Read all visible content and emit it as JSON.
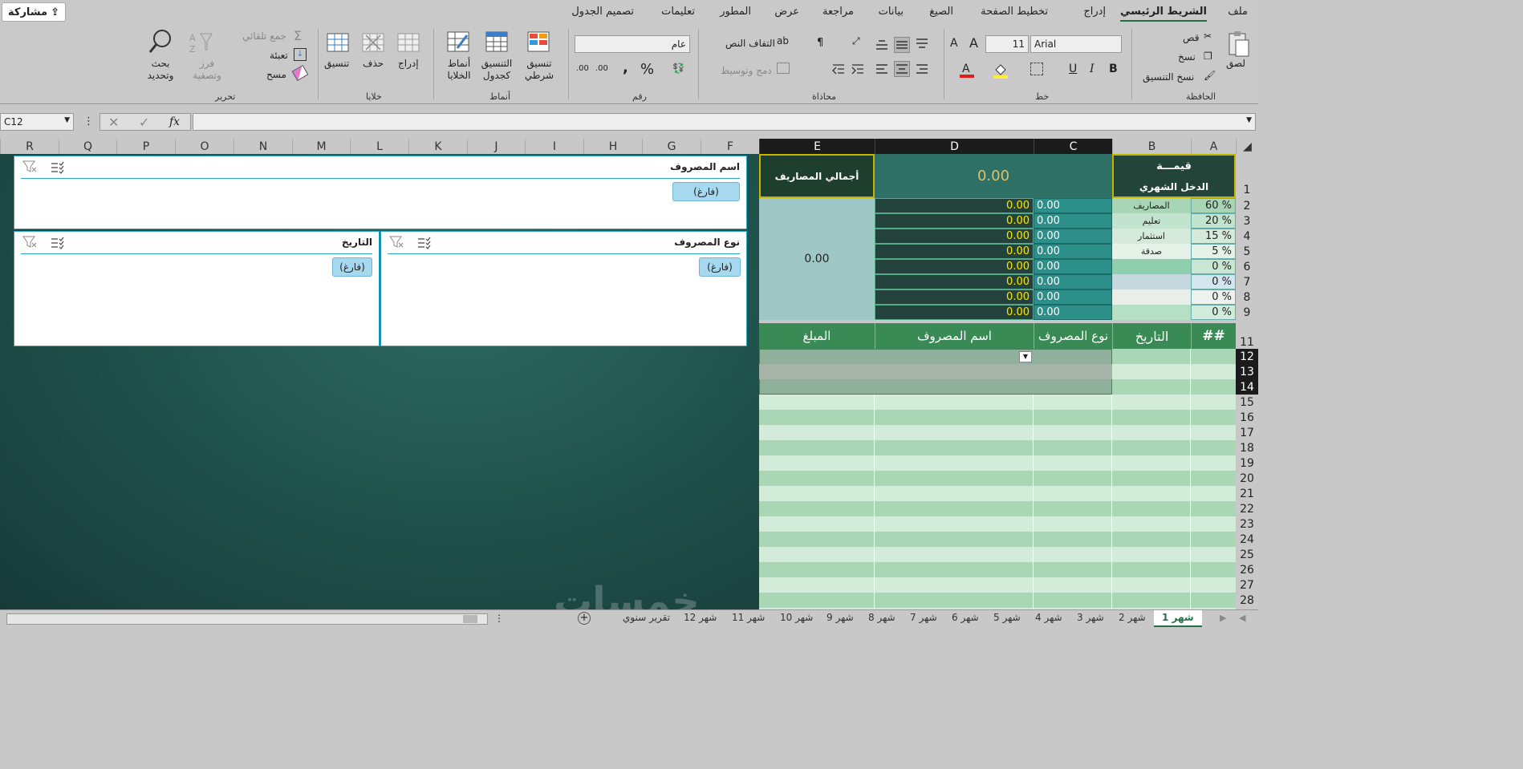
{
  "tabs": [
    "ملف",
    "الشريط الرئيسي",
    "إدراج",
    "تخطيط الصفحة",
    "الصيغ",
    "بيانات",
    "مراجعة",
    "عرض",
    "المطور",
    "تعليمات",
    "تصميم الجدول"
  ],
  "share_label": "مشاركة",
  "ribbon": {
    "clipboard": {
      "paste": "لصق",
      "cut": "قص",
      "copy": "نسخ",
      "format_painter": "نسخ التنسيق",
      "label": "الحافظة"
    },
    "font": {
      "name": "Arial",
      "size": "11",
      "bold": "B",
      "italic": "I",
      "underline": "U",
      "label": "خط"
    },
    "alignment": {
      "wrap": "التفاف النص",
      "merge": "دمج وتوسيط",
      "label": "محاذاة"
    },
    "number": {
      "format": "عام",
      "percent": "%",
      "comma": ",",
      "inc_dec": ".00",
      "label": "رقم"
    },
    "styles": {
      "conditional": "تنسيق شرطي",
      "as_table": "التنسيق كجدول",
      "cell_styles": "أنماط الخلايا",
      "label": "أنماط"
    },
    "cells": {
      "insert": "إدراج",
      "delete": "حذف",
      "format": "تنسيق",
      "label": "خلايا"
    },
    "editing": {
      "autosum": "جمع تلقائي",
      "fill": "تعبئة",
      "clear": "مسح",
      "sort": "فرز وتصفية",
      "find": "بحث وتحديد",
      "label": "تحرير"
    }
  },
  "formula_bar": {
    "name_box": "C12",
    "fx": "fx",
    "formula": ""
  },
  "columns": [
    "A",
    "B",
    "C",
    "D",
    "E",
    "F",
    "G",
    "H",
    "I",
    "J",
    "K",
    "L",
    "M",
    "N",
    "O",
    "P",
    "Q",
    "R"
  ],
  "rows": [
    "1",
    "2",
    "3",
    "4",
    "5",
    "6",
    "7",
    "8",
    "9",
    "11",
    "12",
    "13",
    "14",
    "15",
    "16",
    "17",
    "18",
    "19",
    "20",
    "21",
    "22",
    "23",
    "24",
    "25",
    "26",
    "27",
    "28"
  ],
  "summary": {
    "value_title": "قيمـــة",
    "income_title": "الدخل الشهري",
    "income_value": "0.00",
    "total_expenses_label": "أجمالي المصاريف",
    "total_expenses_value": "0.00",
    "categories": [
      {
        "pct": "60 %",
        "name": "المصاريف",
        "c": "0.00",
        "d": "0.00"
      },
      {
        "pct": "20 %",
        "name": "تعليم",
        "c": "0.00",
        "d": "0.00"
      },
      {
        "pct": "15 %",
        "name": "استثمار",
        "c": "0.00",
        "d": "0.00"
      },
      {
        "pct": "5 %",
        "name": "صدقة",
        "c": "0.00",
        "d": "0.00"
      },
      {
        "pct": "0 %",
        "name": "",
        "c": "0.00",
        "d": "0.00"
      },
      {
        "pct": "0 %",
        "name": "",
        "c": "0.00",
        "d": "0.00"
      },
      {
        "pct": "0 %",
        "name": "",
        "c": "0.00",
        "d": "0.00"
      },
      {
        "pct": "0 %",
        "name": "",
        "c": "0.00",
        "d": "0.00"
      }
    ]
  },
  "table_headers": [
    "##",
    "التاريخ",
    "نوع المصروف",
    "اسم المصروف",
    "المبلغ"
  ],
  "slicers": [
    {
      "title": "اسم المصروف",
      "item": "(فارغ)"
    },
    {
      "title": "نوع المصروف",
      "item": "(فارغ)"
    },
    {
      "title": "التاريخ",
      "item": "(فارغ)"
    }
  ],
  "sheet_tabs": [
    "شهر 1",
    "شهر 2",
    "شهر 3",
    "شهر 4",
    "شهر 5",
    "شهر 6",
    "شهر 7",
    "شهر 8",
    "شهر 9",
    "شهر 10",
    "شهر 11",
    "شهر 12",
    "تقرير سنوي"
  ],
  "watermark": "خمسات",
  "colors": {
    "dark_green": "#1e3e2e",
    "teal": "#2c8f8a",
    "light_green": "#a8d5b5",
    "accent": "#217346"
  }
}
